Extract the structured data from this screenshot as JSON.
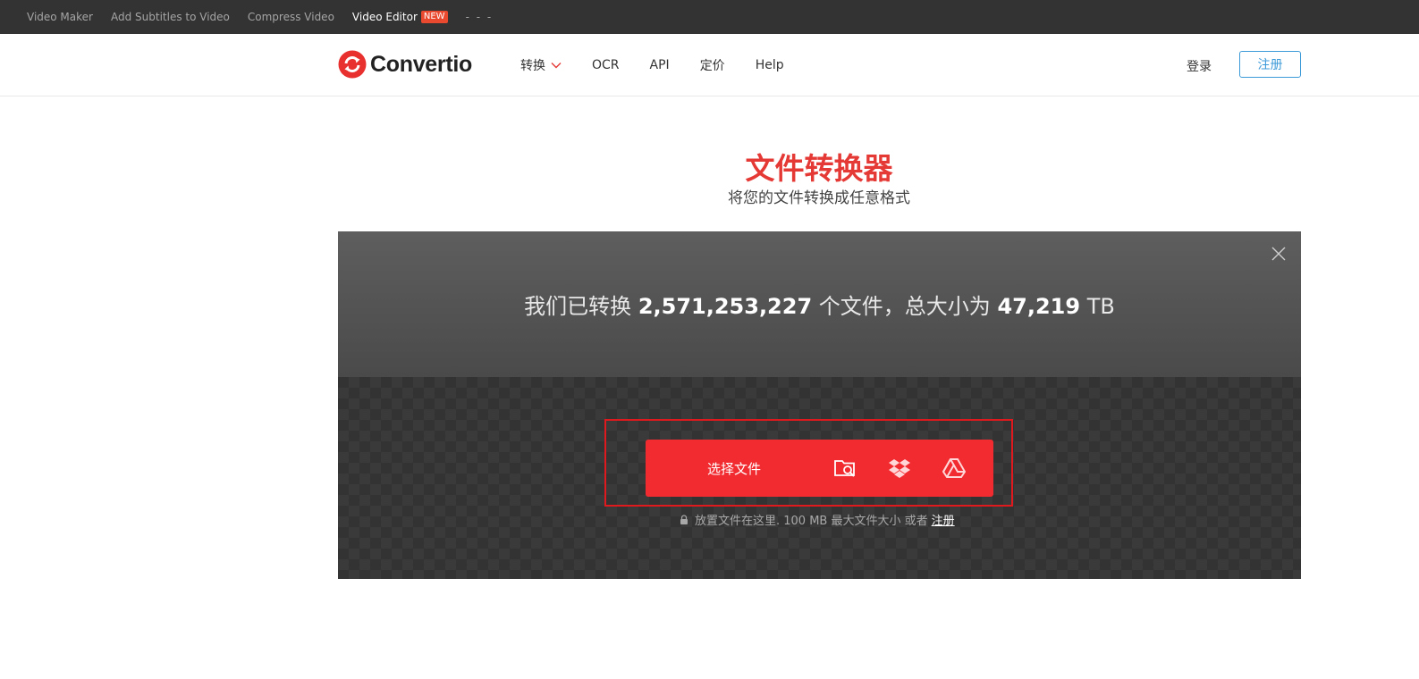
{
  "topbar": {
    "links": [
      "Video Maker",
      "Add Subtitles to Video",
      "Compress Video",
      "Video Editor"
    ],
    "new_badge": "NEW",
    "more": "- - -"
  },
  "header": {
    "brand": "Convertio",
    "nav": [
      "转换",
      "OCR",
      "API",
      "定价",
      "Help"
    ],
    "login": "登录",
    "signup": "注册"
  },
  "hero": {
    "title": "文件转换器",
    "subtitle": "将您的文件转换成任意格式"
  },
  "stats": {
    "prefix": "我们已转换",
    "files_count": "2,571,253,227",
    "middle": "个文件，总大小为",
    "total_size": "47,219",
    "unit": "TB"
  },
  "uploader": {
    "choose_label": "选择文件",
    "sources": [
      "folder-search-icon",
      "dropbox-icon",
      "google-drive-icon"
    ],
    "hint": "放置文件在这里. 100 MB 最大文件大小 或者",
    "hint_link": "注册"
  },
  "colors": {
    "accent": "#f22b30",
    "title": "#e53935",
    "link": "#3d9ad8",
    "topbar": "#333333"
  }
}
